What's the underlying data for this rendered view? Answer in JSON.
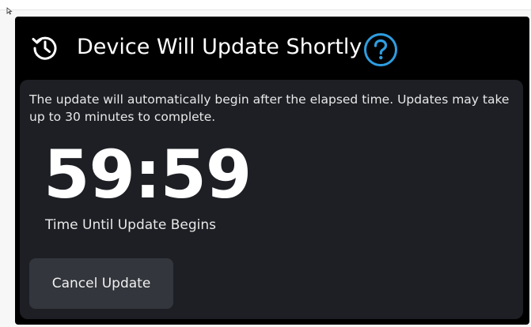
{
  "header": {
    "title": "Device Will Update Shortly",
    "icon": "clock-refresh-icon",
    "help_icon": "help-question-icon",
    "help_icon_color": "#2f9de0"
  },
  "main": {
    "description": "The update will automatically begin after the elapsed time. Updates may take up to 30 minutes to complete.",
    "timer": "59:59",
    "timer_label": "Time Until Update Begins",
    "cancel_label": "Cancel Update"
  }
}
